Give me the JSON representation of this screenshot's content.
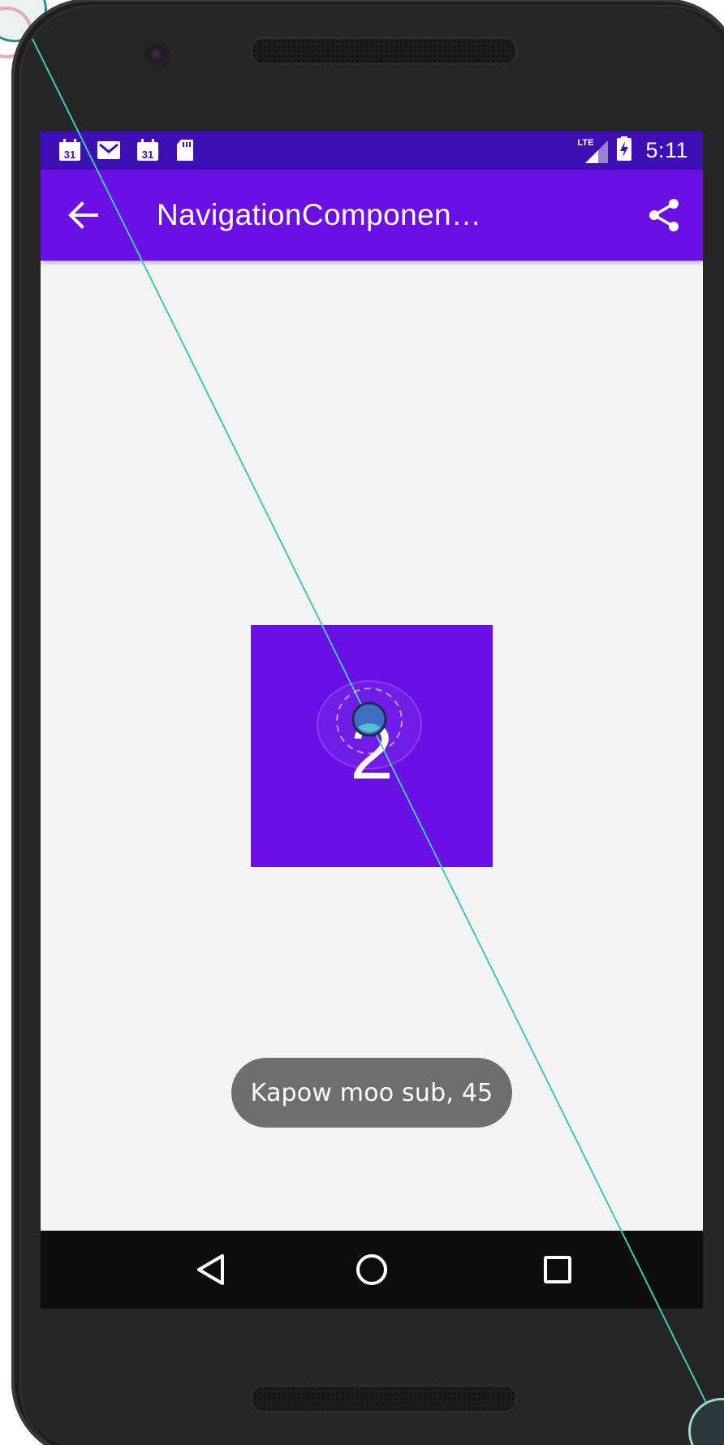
{
  "status_bar": {
    "icons": [
      "calendar-31-icon",
      "gmail-icon",
      "calendar-31-icon",
      "sd-card-icon"
    ],
    "calendar_day": "31",
    "network_label": "LTE",
    "time": "5:11"
  },
  "app_bar": {
    "title": "NavigationComponentExam…",
    "back_icon": "arrow-back-icon",
    "share_icon": "share-icon"
  },
  "content": {
    "number": "2"
  },
  "toast": {
    "message": "Kapow moo sub, 45"
  },
  "nav_bar": {
    "buttons": [
      "back-triangle-icon",
      "home-circle-icon",
      "recents-square-icon"
    ]
  },
  "colors": {
    "status_bar": "#3d0fb4",
    "primary": "#6a0fe6",
    "background": "#f4f4f4",
    "toast": "#6e6e6e",
    "nav_bar": "#0d0d0d",
    "touch_line": "#3ec9b5"
  }
}
